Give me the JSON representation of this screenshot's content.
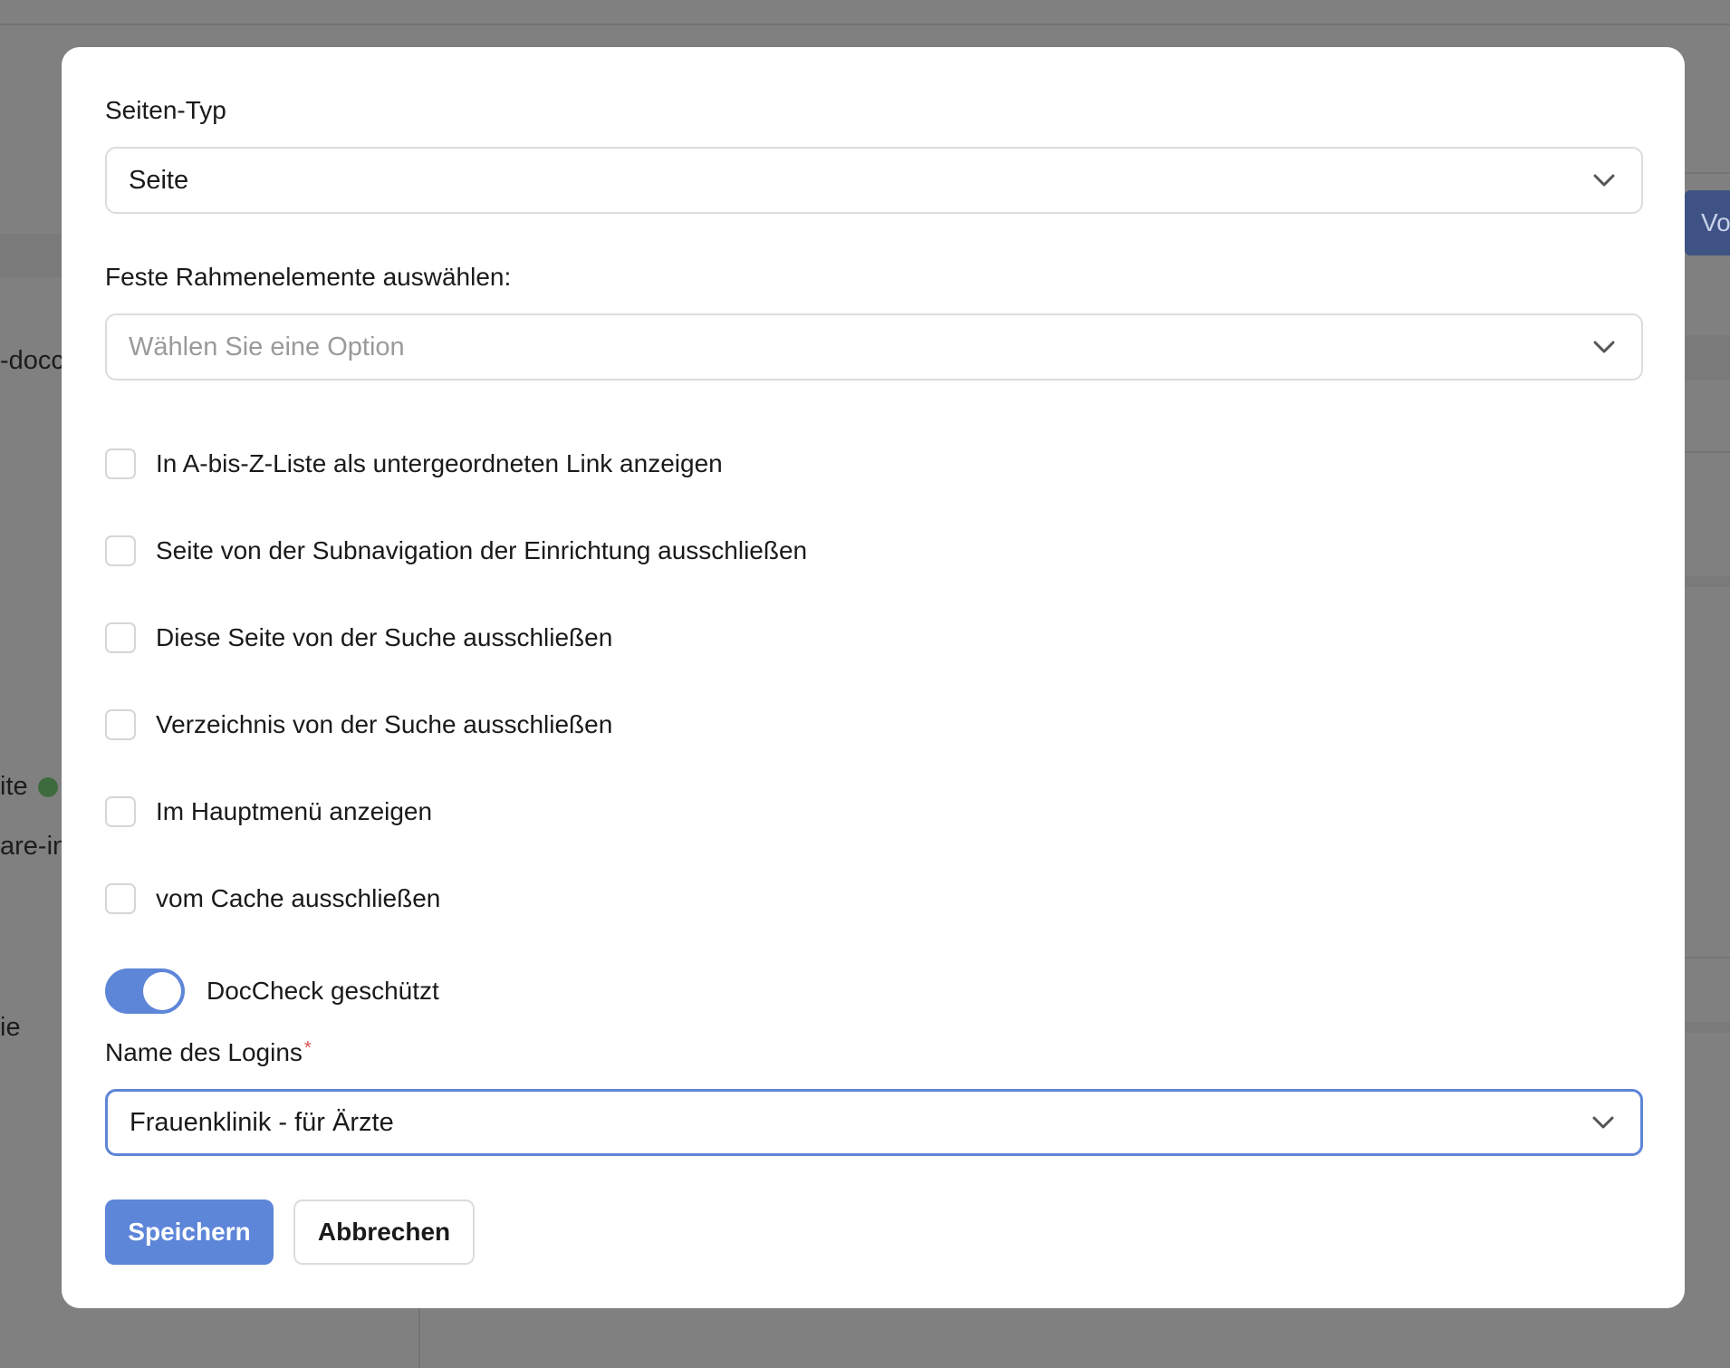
{
  "background": {
    "fragments": [
      "-docc",
      "ite",
      "are-in",
      "ie"
    ],
    "right_button_label": "Vo"
  },
  "modal": {
    "page_type": {
      "label": "Seiten-Typ",
      "value": "Seite"
    },
    "frame_elements": {
      "label": "Feste Rahmenelemente auswählen:",
      "placeholder": "Wählen Sie eine Option"
    },
    "checkboxes": [
      {
        "label": "In A-bis-Z-Liste als untergeordneten Link anzeigen",
        "checked": false
      },
      {
        "label": "Seite von der Subnavigation der Einrichtung ausschließen",
        "checked": false
      },
      {
        "label": "Diese Seite von der Suche ausschließen",
        "checked": false
      },
      {
        "label": "Verzeichnis von der Suche ausschließen",
        "checked": false
      },
      {
        "label": "Im Hauptmenü anzeigen",
        "checked": false
      },
      {
        "label": "vom Cache ausschließen",
        "checked": false
      }
    ],
    "doccheck": {
      "label": "DocCheck geschützt",
      "enabled": true
    },
    "login_name": {
      "label": "Name des Logins",
      "required_mark": "*",
      "value": "Frauenklinik - für Ärzte"
    },
    "buttons": {
      "save": "Speichern",
      "cancel": "Abbrechen"
    },
    "colors": {
      "accent": "#5d85d8",
      "required": "#d9534f"
    }
  }
}
